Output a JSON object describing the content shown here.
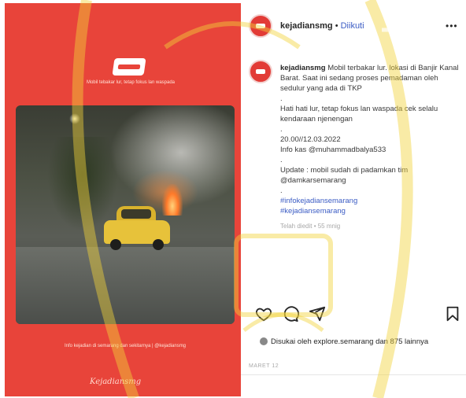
{
  "media": {
    "caption_top": "Mobil tebakar lur, tetap fokus lan waspada",
    "caption_bottom": "Info kejadian di semarang dan sekitarnya | @kejadiansmg",
    "signature": "Kejadiansmg"
  },
  "post": {
    "username": "kejadiansmg",
    "separator": " • ",
    "follow_label": "Diikuti",
    "more_icon": "more-icon",
    "caption_user": "kejadiansmg",
    "caption_lines": [
      "Mobil terbakar lur. lokasi di Banjir Kanal Barat. Saat ini sedang proses pemadaman oleh sedulur yang ada di TKP",
      "Hati hati lur, tetap fokus lan waspada cek selalu kendaraan njenengan",
      "20.00//12.03.2022",
      "Info kas @muhammadbalya533",
      "Update : mobil sudah di padamkan tim @damkarsemarang"
    ],
    "hashtags": [
      "#infokejadiansemarang",
      "#kejadiansemarang"
    ],
    "timestamp": "Telah diedit • 55 mnig",
    "likes_text": "Disukai oleh explore.semarang dan 875 lainnya",
    "date": "MARET 12",
    "icons": [
      "heart-icon",
      "comment-icon",
      "share-icon",
      "bookmark-icon"
    ]
  }
}
